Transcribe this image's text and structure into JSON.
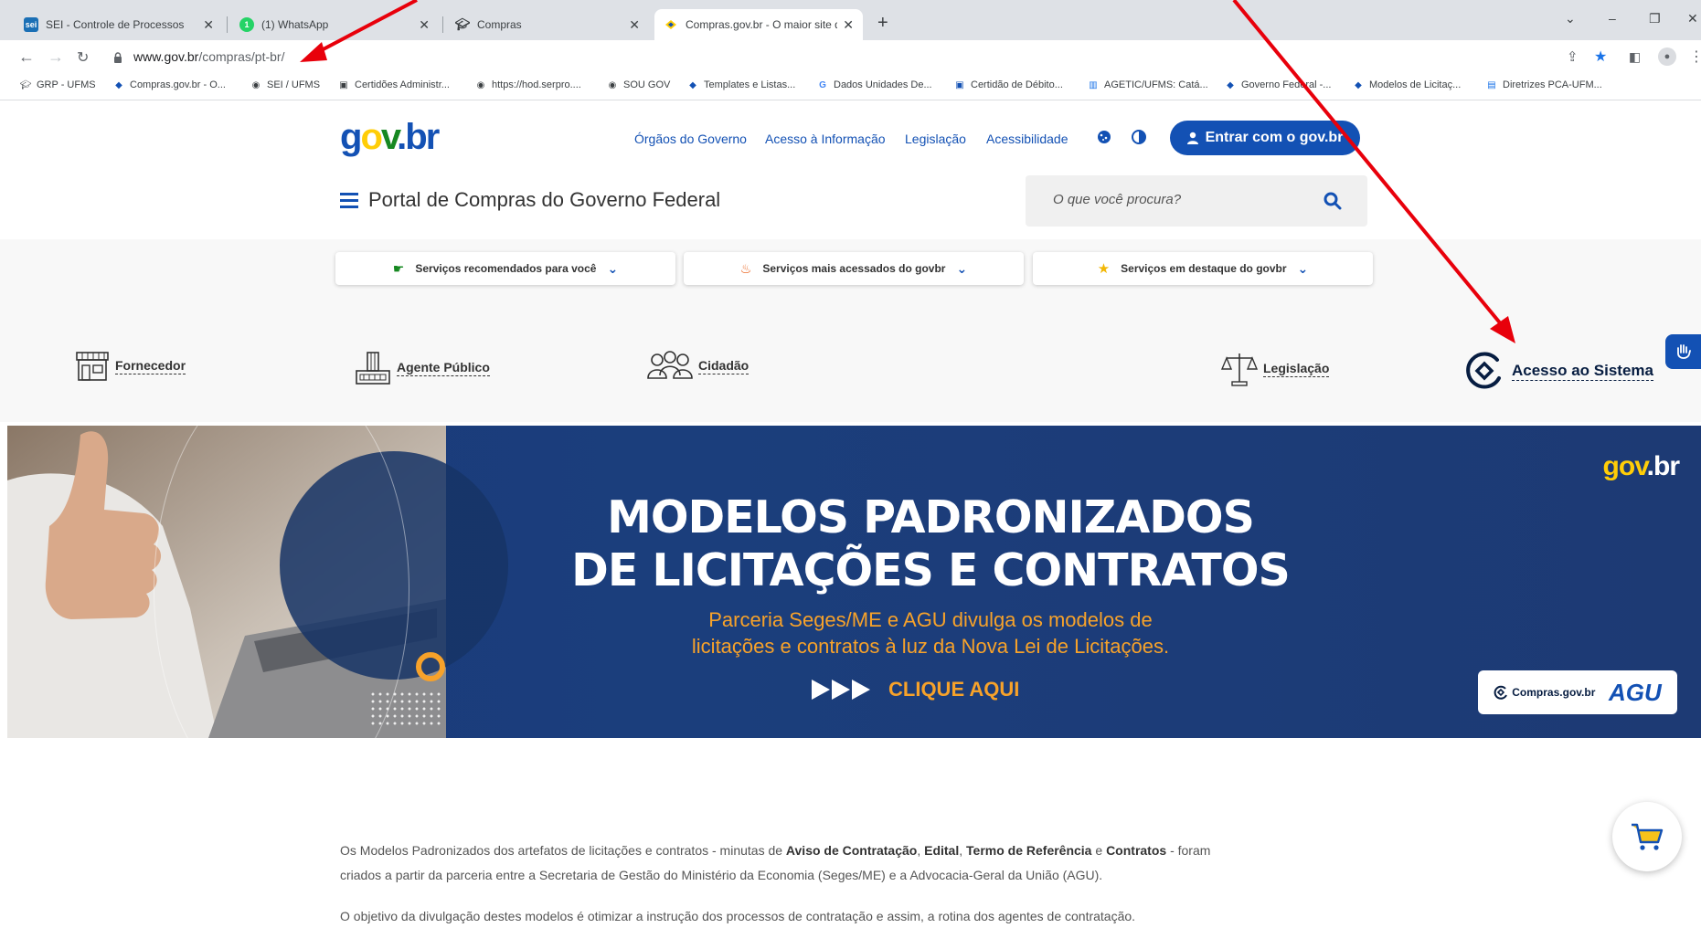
{
  "browser": {
    "tabs": [
      {
        "title": "SEI - Controle de Processos",
        "favicon": "sei"
      },
      {
        "title": "(1) WhatsApp",
        "favicon": "1"
      },
      {
        "title": "Compras",
        "favicon": "cap-icon"
      },
      {
        "title": "Compras.gov.br - O maior site de",
        "favicon": "compras-icon"
      }
    ],
    "url_host": "www.gov.br",
    "url_path": "/compras/pt-br/",
    "bookmarks": [
      "GRP - UFMS",
      "Compras.gov.br - O...",
      "SEI / UFMS",
      "Certidões Administr...",
      "https://hod.serpro....",
      "SOU GOV",
      "Templates e Listas...",
      "Dados Unidades De...",
      "Certidão de Débito...",
      "AGETIC/UFMS: Catá...",
      "Governo Federal -...",
      "Modelos de Licitaç...",
      "Diretrizes PCA-UFM..."
    ]
  },
  "header": {
    "logo": {
      "g": "g",
      "o": "o",
      "v": "v",
      "dot": ".",
      "br": "br"
    },
    "nav": [
      "Órgãos do Governo",
      "Acesso à Informação",
      "Legislação",
      "Acessibilidade"
    ],
    "login_label": "Entrar com o gov.br",
    "portal_title": "Portal de Compras do Governo Federal",
    "search_placeholder": "O que você procura?"
  },
  "services": [
    {
      "label": "Serviços recomendados para você",
      "icon": "thumbs-up-icon"
    },
    {
      "label": "Serviços mais acessados do govbr",
      "icon": "flame-icon"
    },
    {
      "label": "Serviços em destaque do govbr",
      "icon": "star-icon"
    }
  ],
  "categories": [
    "Fornecedor",
    "Agente Público",
    "Cidadão",
    "Legislação"
  ],
  "access_system": "Acesso ao Sistema",
  "banner": {
    "title_line1": "MODELOS PADRONIZADOS",
    "title_line2": "DE LICITAÇÕES E CONTRATOS",
    "subtitle_line1": "Parceria Seges/ME e AGU divulga os modelos de",
    "subtitle_line2": "licitações e contratos à luz da Nova Lei de Licitações.",
    "cta": "CLIQUE AQUI",
    "badge_left": "Compras.gov.br",
    "badge_right": "AGU"
  },
  "body": {
    "p1_a": "Os Modelos Padronizados dos artefatos de licitações e contratos - minutas de ",
    "p1_b1": "Aviso de Contratação",
    "p1_sep1": ", ",
    "p1_b2": "Edital",
    "p1_sep2": ", ",
    "p1_b3": "Termo de Referência",
    "p1_sep3": " e ",
    "p1_b4": "Contratos",
    "p1_c": " - foram",
    "p1_line2": "criados a partir da parceria entre a Secretaria de Gestão do Ministério da Economia (Seges/ME) e a Advocacia-Geral da União (AGU).",
    "p2": "O objetivo da divulgação destes modelos é otimizar a instrução dos processos de contratação e assim, a rotina dos agentes de contratação."
  },
  "colors": {
    "govbr_blue": "#1351b4",
    "banner_orange": "#f7a22a",
    "annotation_red": "#e8000b"
  }
}
